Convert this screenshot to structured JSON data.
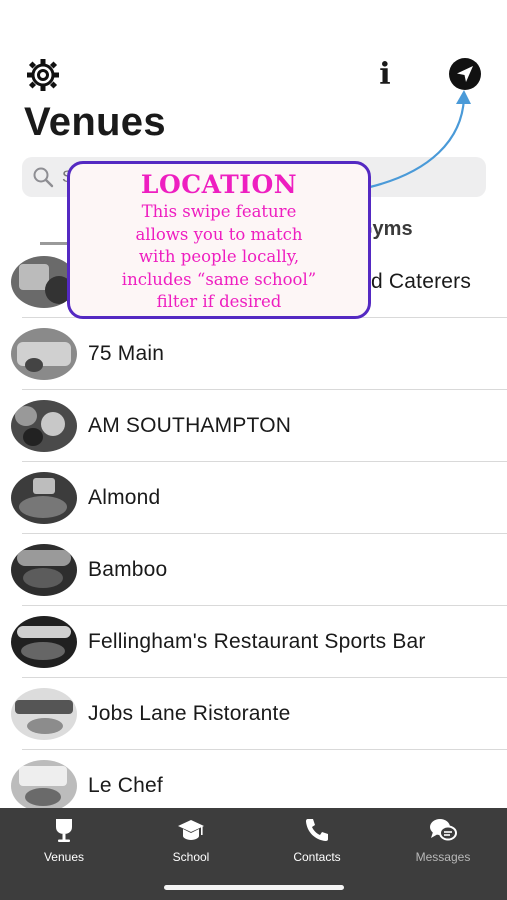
{
  "header": {
    "title": "Venues",
    "info_label": "i"
  },
  "search": {
    "placeholder": "Search",
    "value": ""
  },
  "tabs": [
    {
      "label": "Gyms"
    }
  ],
  "venues": [
    {
      "name": "Hampton Coffee and Caterers",
      "visible_name": "d Caterers"
    },
    {
      "name": "75 Main"
    },
    {
      "name": "AM SOUTHAMPTON"
    },
    {
      "name": "Almond"
    },
    {
      "name": "Bamboo"
    },
    {
      "name": "Fellingham's Restaurant Sports Bar"
    },
    {
      "name": "Jobs Lane Ristorante"
    },
    {
      "name": "Le Chef"
    }
  ],
  "callout": {
    "title": "LOCATION",
    "lines": [
      "This swipe feature",
      "allows you to match",
      "with people locally,",
      "includes “same school”",
      "filter if desired"
    ],
    "accent": "#ee1ec0",
    "border": "#5429c2"
  },
  "nav": [
    {
      "label": "Venues",
      "icon": "wine-glass-icon"
    },
    {
      "label": "School",
      "icon": "graduation-cap-icon"
    },
    {
      "label": "Contacts",
      "icon": "phone-icon"
    },
    {
      "label": "Messages",
      "icon": "chat-bubbles-icon"
    }
  ],
  "colors": {
    "navbar": "#3d3d3d",
    "search_bg": "#eeeeef",
    "arrow": "#4a9ad8"
  }
}
